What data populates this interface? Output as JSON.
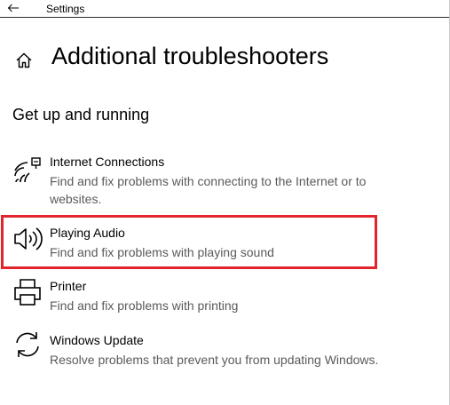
{
  "window": {
    "title": "Settings"
  },
  "page": {
    "title": "Additional troubleshooters",
    "section_heading": "Get up and running"
  },
  "troubleshooters": [
    {
      "name": "Internet Connections",
      "description": "Find and fix problems with connecting to the Internet or to websites.",
      "icon": "wifi-icon"
    },
    {
      "name": "Playing Audio",
      "description": "Find and fix problems with playing sound",
      "icon": "speaker-icon",
      "highlighted": true
    },
    {
      "name": "Printer",
      "description": "Find and fix problems with printing",
      "icon": "printer-icon"
    },
    {
      "name": "Windows Update",
      "description": "Resolve problems that prevent you from updating Windows.",
      "icon": "refresh-icon"
    }
  ],
  "colors": {
    "highlight": "#e3242b",
    "description_text": "#5a5a5a"
  }
}
